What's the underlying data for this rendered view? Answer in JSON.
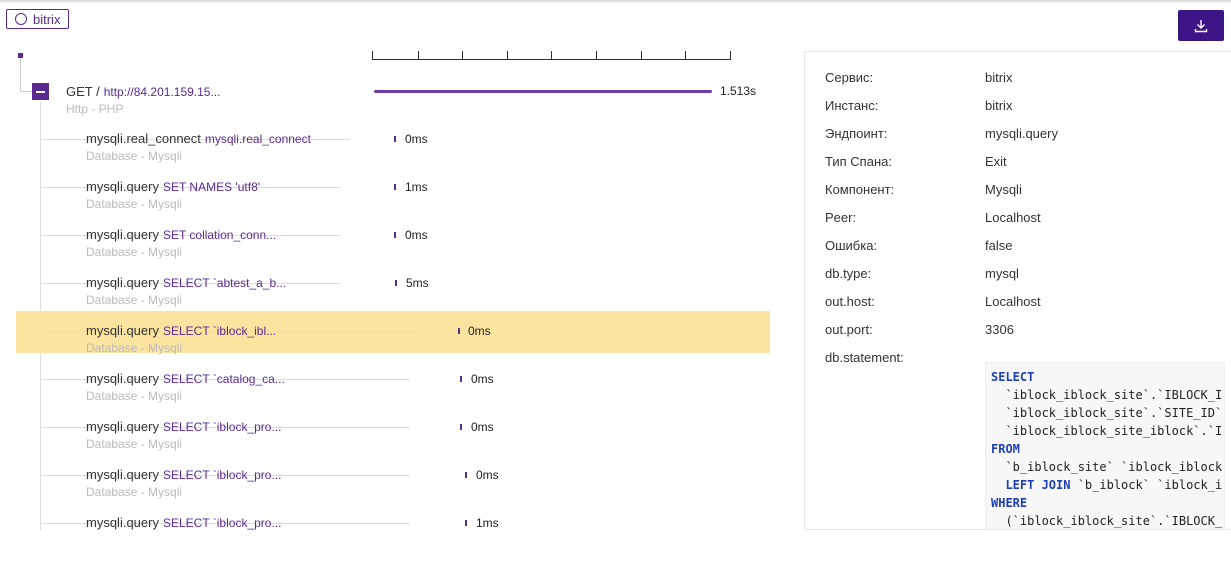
{
  "service_tag": "bitrix",
  "root": {
    "method": "GET /",
    "url": "http://84.201.159.15...",
    "subtitle": "Http - PHP",
    "duration": "1.513s"
  },
  "spans": [
    {
      "name": "mysqli.real_connect",
      "statement": "mysqli.real_connect",
      "subtitle": "Database - Mysqli",
      "duration": "0ms"
    },
    {
      "name": "mysqli.query",
      "statement": "SET NAMES 'utf8'",
      "subtitle": "Database - Mysqli",
      "duration": "1ms"
    },
    {
      "name": "mysqli.query",
      "statement": "SET collation_conn...",
      "subtitle": "Database - Mysqli",
      "duration": "0ms"
    },
    {
      "name": "mysqli.query",
      "statement": "SELECT `abtest_a_b...",
      "subtitle": "Database - Mysqli",
      "duration": "5ms"
    },
    {
      "name": "mysqli.query",
      "statement": "SELECT `iblock_ibl...",
      "subtitle": "Database - Mysqli",
      "duration": "0ms"
    },
    {
      "name": "mysqli.query",
      "statement": "SELECT `catalog_ca...",
      "subtitle": "Database - Mysqli",
      "duration": "0ms"
    },
    {
      "name": "mysqli.query",
      "statement": "SELECT `iblock_pro...",
      "subtitle": "Database - Mysqli",
      "duration": "0ms"
    },
    {
      "name": "mysqli.query",
      "statement": "SELECT `iblock_pro...",
      "subtitle": "Database - Mysqli",
      "duration": "0ms"
    },
    {
      "name": "mysqli.query",
      "statement": "SELECT `iblock_pro...",
      "subtitle": "",
      "duration": "1ms"
    }
  ],
  "details": [
    {
      "key": "Сервис:",
      "value": "bitrix"
    },
    {
      "key": "Инстанс:",
      "value": "bitrix"
    },
    {
      "key": "Эндпоинт:",
      "value": "mysqli.query"
    },
    {
      "key": "Тип Спана:",
      "value": "Exit"
    },
    {
      "key": "Компонент:",
      "value": "Mysqli"
    },
    {
      "key": "Peer:",
      "value": "Localhost"
    },
    {
      "key": "Ошибка:",
      "value": "false"
    },
    {
      "key": "db.type:",
      "value": "mysql"
    },
    {
      "key": "out.host:",
      "value": "Localhost"
    },
    {
      "key": "out.port:",
      "value": "3306"
    }
  ],
  "statement_label": "db.statement:",
  "statement_lines": [
    {
      "kw": "SELECT",
      "text": ""
    },
    {
      "kw": "",
      "text": "  `iblock_iblock_site`.`IBLOCK_I"
    },
    {
      "kw": "",
      "text": "  `iblock_iblock_site`.`SITE_ID`"
    },
    {
      "kw": "",
      "text": "  `iblock_iblock_site_iblock`.`I"
    },
    {
      "kw": "FROM",
      "text": ""
    },
    {
      "kw": "",
      "text": "  `b_iblock_site` `iblock_iblock"
    },
    {
      "kw": "  LEFT JOIN",
      "text": " `b_iblock` `iblock_i"
    },
    {
      "kw": "WHERE",
      "text": ""
    },
    {
      "kw": "",
      "text": "  (`iblock_iblock_site`.`IBLOCK_"
    }
  ],
  "colors": {
    "accent": "#5b2a91",
    "selected": "#fae49f",
    "button": "#3d1485"
  }
}
